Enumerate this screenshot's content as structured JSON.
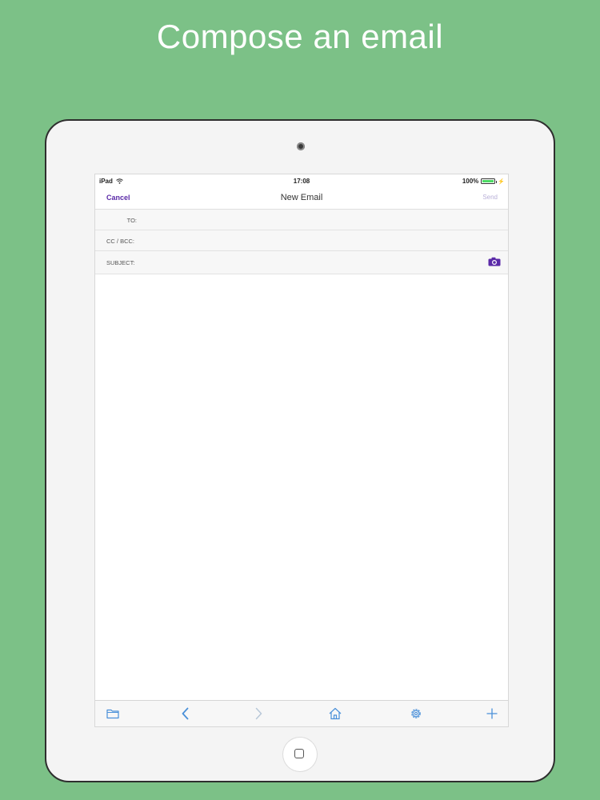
{
  "headline": "Compose an email",
  "colors": {
    "background": "#7cc187",
    "accent": "#5b2aa8",
    "send_disabled": "#b9b0d8",
    "toolbar_icon": "#4a90d9",
    "toolbar_icon_disabled": "#b8c8d8",
    "battery": "#4cd964"
  },
  "status_bar": {
    "device": "iPad",
    "time": "17:08",
    "battery_percent": "100%",
    "battery_level": 1.0,
    "icons": [
      "wifi-icon",
      "battery-icon",
      "charge-icon"
    ]
  },
  "nav": {
    "cancel_label": "Cancel",
    "title": "New Email",
    "send_label": "Send"
  },
  "fields": {
    "to_label": "TO:",
    "to_value": "",
    "cc_bcc_label": "CC / BCC:",
    "cc_bcc_value": "",
    "subject_label": "SUBJECT:",
    "subject_value": "",
    "subject_icon": "camera-icon"
  },
  "body": {
    "value": ""
  },
  "toolbar": {
    "items": [
      {
        "name": "folder",
        "icon": "folder-icon",
        "enabled": true
      },
      {
        "name": "back",
        "icon": "chevron-left-icon",
        "enabled": true
      },
      {
        "name": "forward",
        "icon": "chevron-right-icon",
        "enabled": false
      },
      {
        "name": "home",
        "icon": "home-icon",
        "enabled": true
      },
      {
        "name": "settings",
        "icon": "gear-icon",
        "enabled": true
      },
      {
        "name": "add",
        "icon": "plus-icon",
        "enabled": true
      }
    ]
  }
}
